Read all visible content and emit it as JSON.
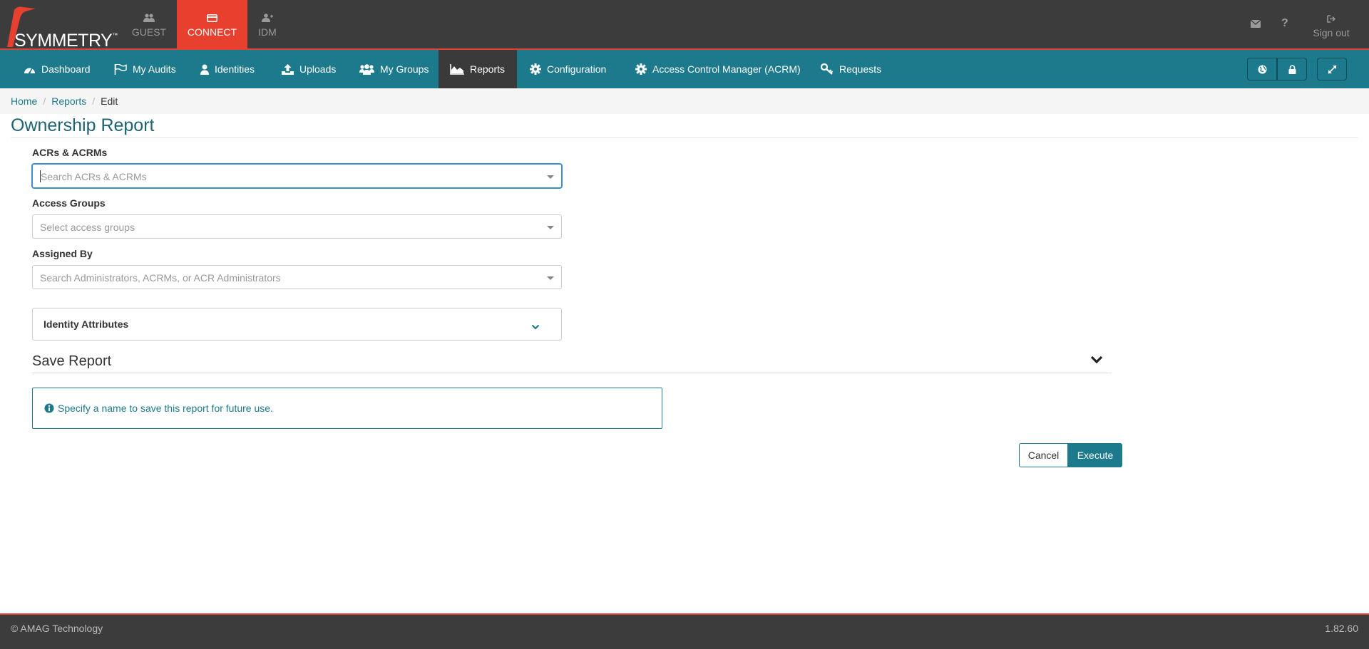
{
  "brand": {
    "name": "SYMMETRY",
    "trademark": "™"
  },
  "app_tabs": [
    {
      "label": "GUEST",
      "icon": "users-icon"
    },
    {
      "label": "CONNECT",
      "icon": "card-icon",
      "active": true
    },
    {
      "label": "IDM",
      "icon": "user-plus-icon"
    }
  ],
  "top_right": {
    "mail_icon": "envelope-icon",
    "help_icon": "question-icon",
    "signout_label": "Sign out"
  },
  "nav": {
    "items": [
      {
        "label": "Dashboard",
        "icon": "dashboard-icon"
      },
      {
        "label": "My Audits",
        "icon": "flag-icon"
      },
      {
        "label": "Identities",
        "icon": "user-icon"
      },
      {
        "label": "Uploads",
        "icon": "upload-icon"
      },
      {
        "label": "My Groups",
        "icon": "users-icon"
      },
      {
        "label": "Reports",
        "icon": "area-chart-icon",
        "active": true
      },
      {
        "label": "Configuration",
        "icon": "gear-icon"
      },
      {
        "label": "Access Control Manager (ACRM)",
        "icon": "gear-icon"
      },
      {
        "label": "Requests",
        "icon": "key-icon"
      }
    ],
    "buttons": [
      "globe-icon",
      "lock-icon",
      "expand-icon"
    ]
  },
  "breadcrumb": {
    "home": "Home",
    "reports": "Reports",
    "current": "Edit"
  },
  "page": {
    "title": "Ownership Report",
    "fields": [
      {
        "label": "ACRs & ACRMs",
        "placeholder": "Search ACRs & ACRMs"
      },
      {
        "label": "Access Groups",
        "placeholder": "Select access groups"
      },
      {
        "label": "Assigned By",
        "placeholder": "Search Administrators, ACRMs, or ACR Administrators"
      }
    ],
    "identity_attributes": "Identity Attributes",
    "save_report": "Save Report",
    "info_message": "Specify a name to save this report for future use.",
    "cancel_label": "Cancel",
    "execute_label": "Execute"
  },
  "footer": {
    "copyright": "© AMAG Technology",
    "version": "1.82.60"
  },
  "colors": {
    "brand_red": "#e8402f",
    "teal": "#1d7a8c",
    "dark": "#3c3c3c"
  }
}
